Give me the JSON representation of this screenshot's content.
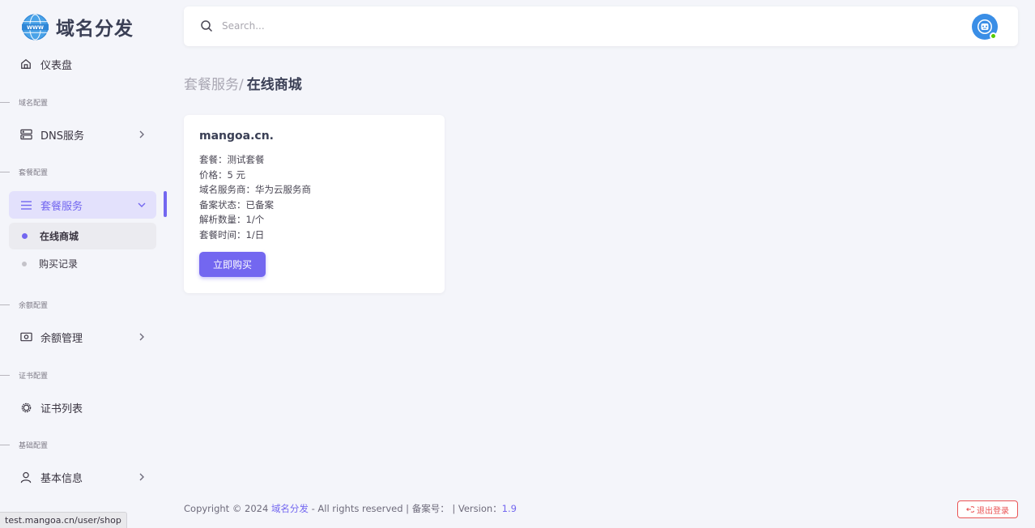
{
  "brand": {
    "name": "域名分发",
    "logo_text": "WWW"
  },
  "search": {
    "placeholder": "Search..."
  },
  "sidebar": {
    "dashboard": "仪表盘",
    "sections": {
      "domain": "域名配置",
      "package": "套餐配置",
      "balance": "余额配置",
      "cert": "证书配置",
      "basic": "基础配置"
    },
    "items": {
      "dns": "DNS服务",
      "package_service": "套餐服务",
      "shop": "在线商城",
      "purchase_records": "购买记录",
      "balance_manage": "余额管理",
      "cert_list": "证书列表",
      "basic_info": "基本信息"
    }
  },
  "breadcrumb": {
    "parent": "套餐服务/",
    "current": "在线商城"
  },
  "card": {
    "title": "mangoa.cn.",
    "lines": [
      "套餐：测试套餐",
      "价格：5 元",
      "域名服务商：华为云服务商",
      "备案状态：已备案",
      "解析数量：1/个",
      "套餐时间：1/日"
    ],
    "buy_label": "立即购买"
  },
  "footer": {
    "prefix": "Copyright © 2024 ",
    "brand_link": "域名分发",
    "middle": " - All rights reserved | 备案号： | Version：",
    "version": "1.9",
    "logout_label": "退出登录"
  },
  "status_url": "test.mangoa.cn/user/shop",
  "colors": {
    "primary": "#7367f0",
    "danger": "#ea5455",
    "online": "#56ca00",
    "avatar": "#3a8ee6"
  }
}
